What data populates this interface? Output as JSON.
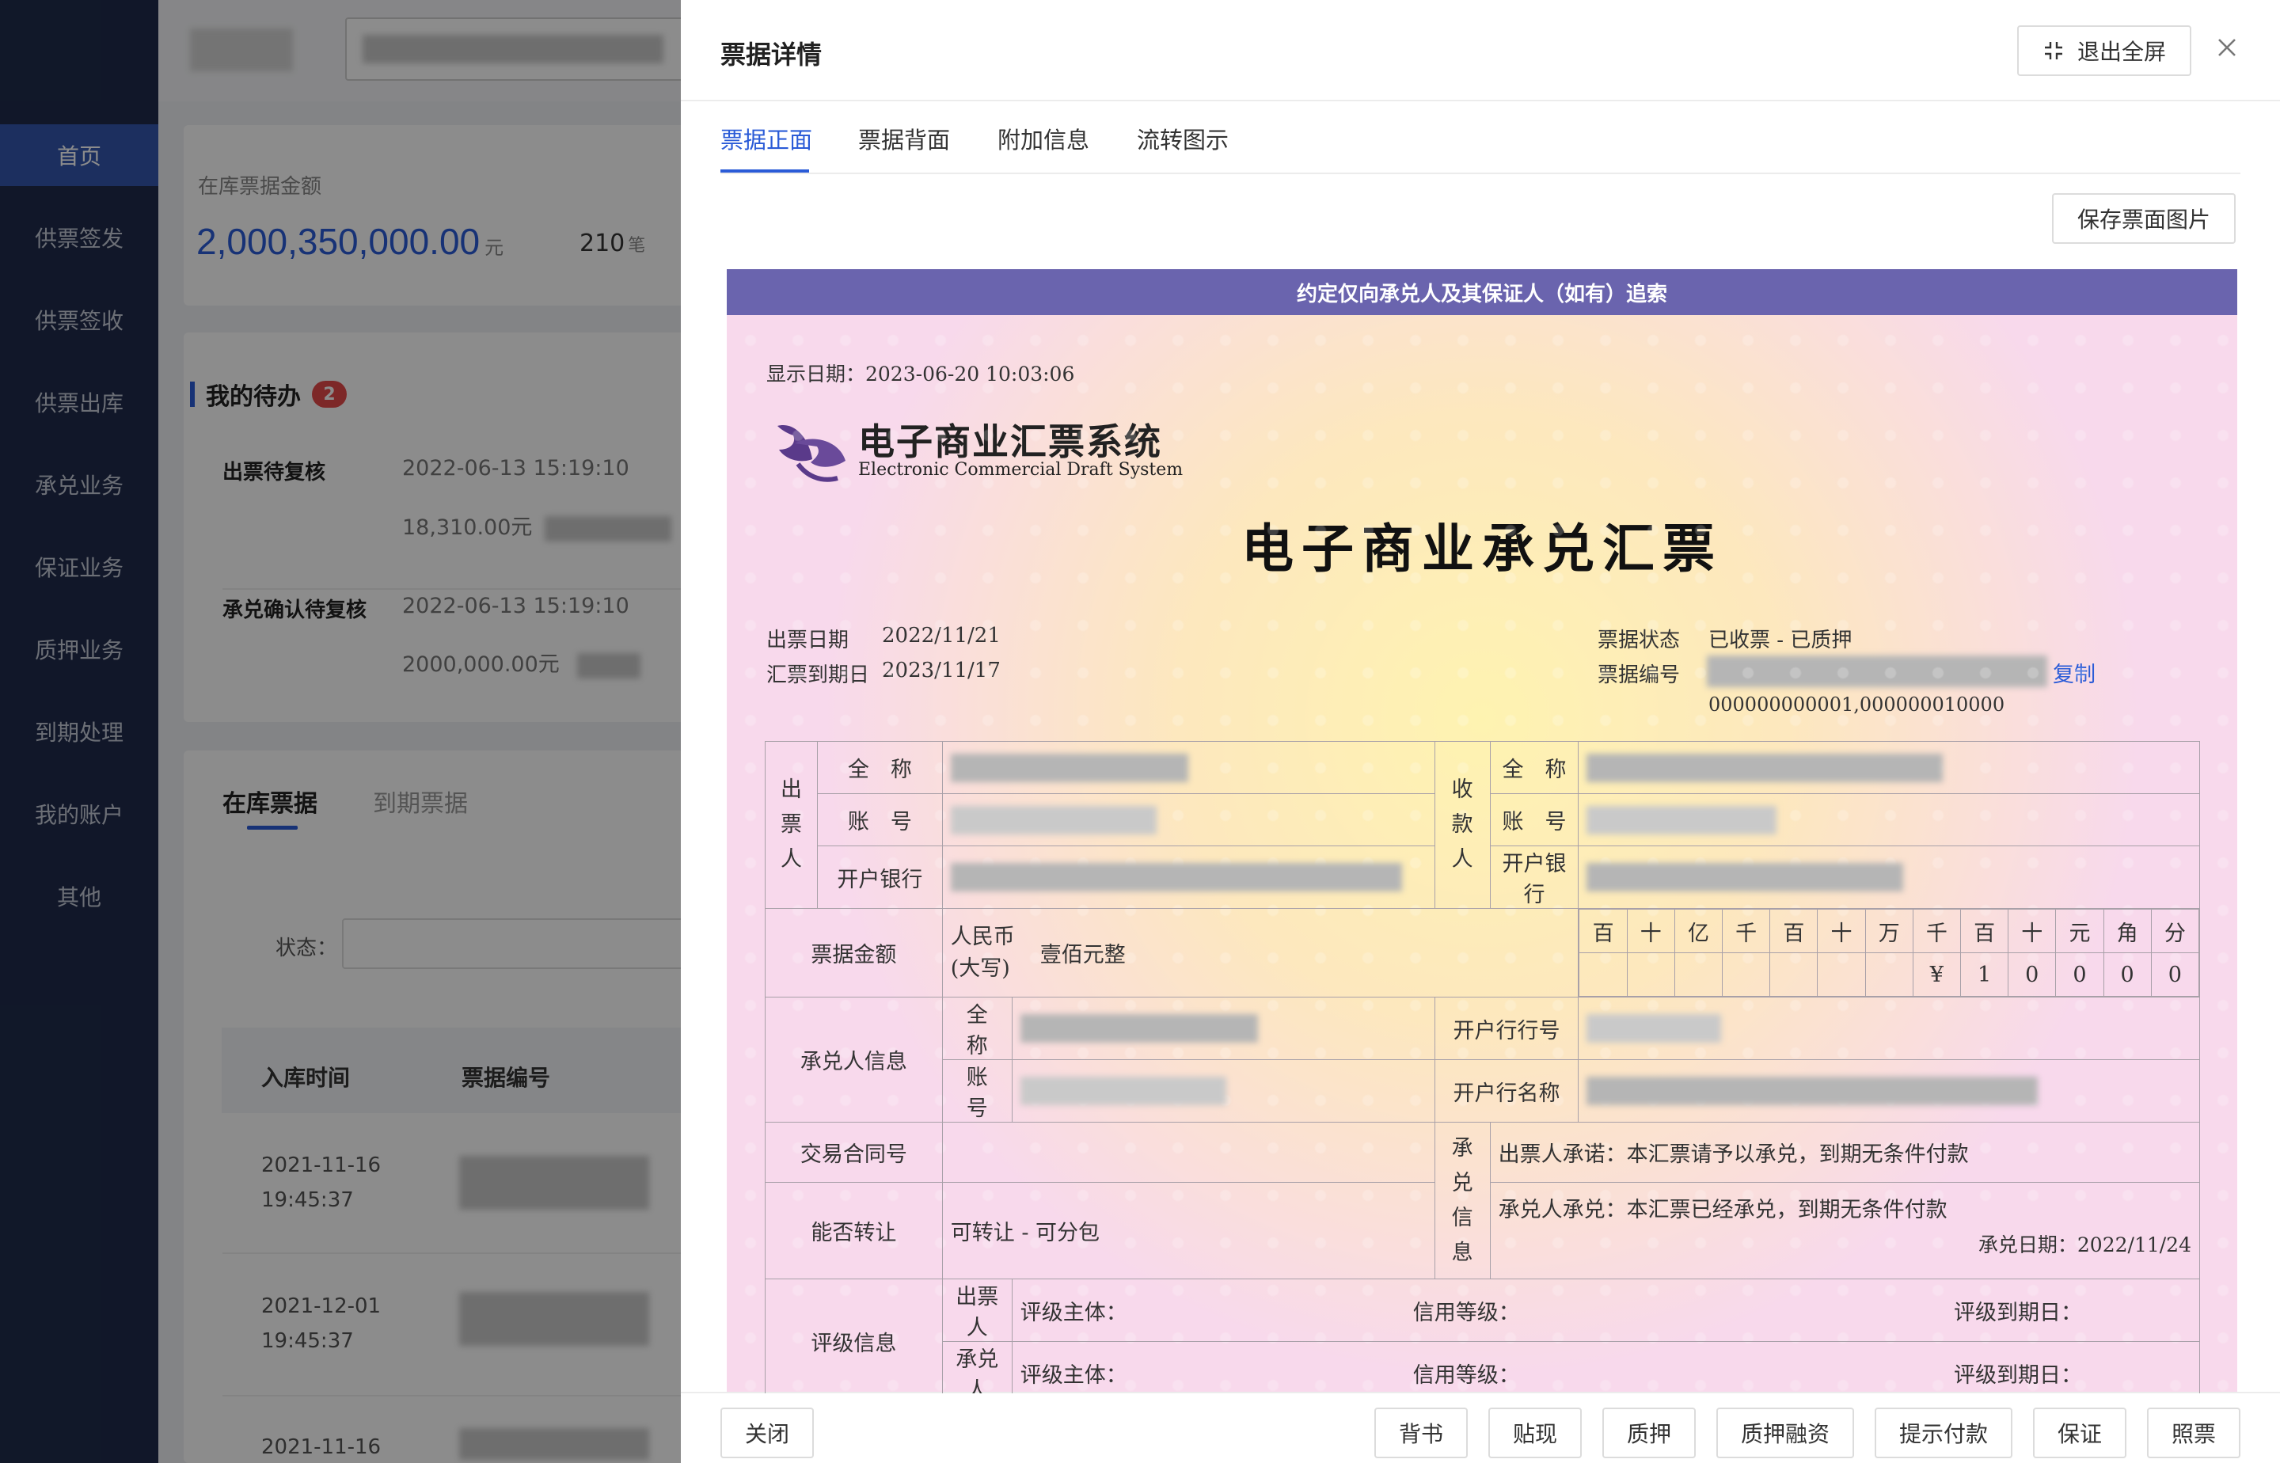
{
  "sidebar": {
    "items": [
      {
        "label": "首页",
        "active": true
      },
      {
        "label": "供票签发"
      },
      {
        "label": "供票签收"
      },
      {
        "label": "供票出库"
      },
      {
        "label": "承兑业务"
      },
      {
        "label": "保证业务"
      },
      {
        "label": "质押业务"
      },
      {
        "label": "到期处理"
      },
      {
        "label": "我的账户"
      },
      {
        "label": "其他"
      }
    ]
  },
  "summary": {
    "label": "在库票据金额",
    "amount": "2,000,350,000.00",
    "unit": "元",
    "count": "210",
    "count_unit": "笔"
  },
  "todo": {
    "title": "我的待办",
    "badge": "2",
    "items": [
      {
        "name": "出票待复核",
        "time": "2022-06-13 15:19:10",
        "amount": "18,310.00元"
      },
      {
        "name": "承兑确认待复核",
        "time": "2022-06-13 15:19:10",
        "amount": "2000,000.00元"
      }
    ]
  },
  "bill_tabs": [
    "在库票据",
    "到期票据"
  ],
  "filter": {
    "label": "状态："
  },
  "table": {
    "headers": [
      "入库时间",
      "票据编号"
    ],
    "rows": [
      {
        "date": "2021-11-16",
        "time": "19:45:37"
      },
      {
        "date": "2021-12-01",
        "time": "19:45:37"
      },
      {
        "date": "2021-11-16",
        "time": ""
      }
    ]
  },
  "drawer": {
    "title": "票据详情",
    "exit_fullscreen": "退出全屏",
    "tabs": [
      "票据正面",
      "票据背面",
      "附加信息",
      "流转图示"
    ],
    "save_image": "保存票面图片"
  },
  "ticket": {
    "banner": "约定仅向承兑人及其保证人（如有）追索",
    "display_date": "显示日期：2023-06-20 10:03:06",
    "logo_cn": "电子商业汇票系统",
    "logo_en": "Electronic Commercial Draft System",
    "title": "电子商业承兑汇票",
    "issue_date_label": "出票日期",
    "issue_date": "2022/11/21",
    "due_date_label": "汇票到期日",
    "due_date": "2023/11/17",
    "status_label": "票据状态",
    "status": "已收票 - 已质押",
    "number_label": "票据编号",
    "copy": "复制",
    "sub_range": "000000000001,000000010000",
    "drawer_label": [
      "出",
      "票",
      "人"
    ],
    "payee_label": [
      "收",
      "款",
      "人"
    ],
    "full_name": "全　称",
    "account": "账　号",
    "bank": "开户银行",
    "amount_label": "票据金额",
    "rmb_label": "人民币",
    "capital_label": "(大写)",
    "amount_capital": "壹佰元整",
    "digit_heads": [
      "百",
      "十",
      "亿",
      "千",
      "百",
      "十",
      "万",
      "千",
      "百",
      "十",
      "元",
      "角",
      "分"
    ],
    "digit_vals": [
      "",
      "",
      "",
      "",
      "",
      "",
      "",
      "¥",
      "1",
      "0",
      "0",
      "0",
      "0"
    ],
    "acceptor_label": "承兑人信息",
    "bank_no_label": "开户行行号",
    "bank_name_label": "开户行名称",
    "contract_label": "交易合同号",
    "accept_info_label": [
      "承",
      "兑",
      "信",
      "息"
    ],
    "drawer_promise": "出票人承诺：本汇票请予以承兑，到期无条件付款",
    "acceptor_promise": "承兑人承兑：本汇票已经承兑，到期无条件付款",
    "accept_date": "承兑日期：2022/11/24",
    "transferable_label": "能否转让",
    "transferable": "可转让 - 可分包",
    "rating_label": "评级信息",
    "rating_drawer": "出票人",
    "rating_acceptor": "承兑人",
    "rating_subject": "评级主体：",
    "credit_level": "信用等级：",
    "rating_due": "评级到期日："
  },
  "footer": {
    "close": "关闭",
    "actions": [
      "背书",
      "贴现",
      "质押",
      "质押融资",
      "提示付款",
      "保证",
      "照票"
    ]
  },
  "colors": {
    "primary": "#2a5bd7",
    "sidebar": "#1f2b4b",
    "banner": "#6a64ae"
  }
}
